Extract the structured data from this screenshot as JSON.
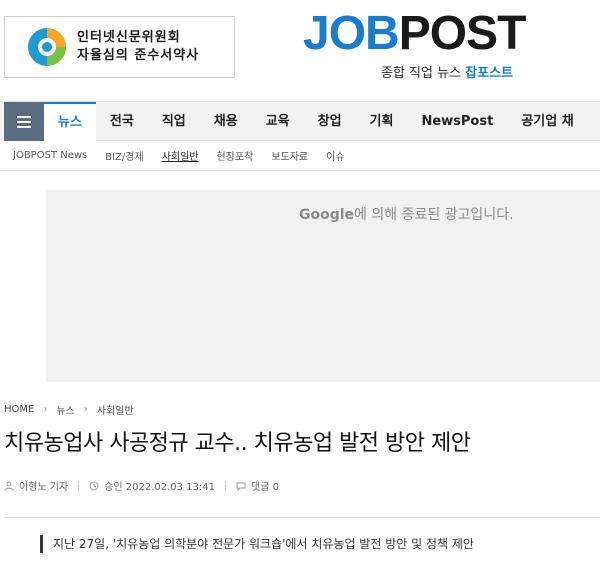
{
  "header": {
    "ad_line1": "인터넷신문위원회",
    "ad_line2": "자율심의 준수서약사",
    "logo_j": "J",
    "logo_ob": "OB",
    "logo_post": "POST",
    "logo_sub_prefix": "종합 직업 뉴스",
    "logo_sub_brand": "잡포스트"
  },
  "nav": {
    "items": [
      {
        "label": "뉴스"
      },
      {
        "label": "전국"
      },
      {
        "label": "직업"
      },
      {
        "label": "채용"
      },
      {
        "label": "교육"
      },
      {
        "label": "창업"
      },
      {
        "label": "기획"
      },
      {
        "label": "NewsPost"
      },
      {
        "label": "공기업 채"
      }
    ]
  },
  "subnav": {
    "items": [
      {
        "label": "JOBPOST News"
      },
      {
        "label": "BIZ/경제"
      },
      {
        "label": "사회일반"
      },
      {
        "label": "현장포착"
      },
      {
        "label": "보도자료"
      },
      {
        "label": "이슈"
      }
    ]
  },
  "ad": {
    "brand": "Google",
    "message": "에 의해 종료된 광고입니다."
  },
  "breadcrumb": {
    "items": [
      "HOME",
      "뉴스",
      "사회일반"
    ]
  },
  "article": {
    "title": "치유농업사 사공정규 교수.. 치유농업 발전 방안 제안",
    "author": "이형노 기자",
    "approved": "승인 2022.02.03 13:41",
    "comments": "댓글 0",
    "lead": "지난 27일, '치유농업 의학분야 전문가 워크숍'에서 치유농업 발전 방안 및 정책 제안"
  },
  "colors": {
    "accent": "#1a7bcf",
    "menu_button": "#5a6a80"
  },
  "icons": [
    "menu-icon",
    "person-icon",
    "clock-icon",
    "comment-icon",
    "chevron-right-icon"
  ]
}
